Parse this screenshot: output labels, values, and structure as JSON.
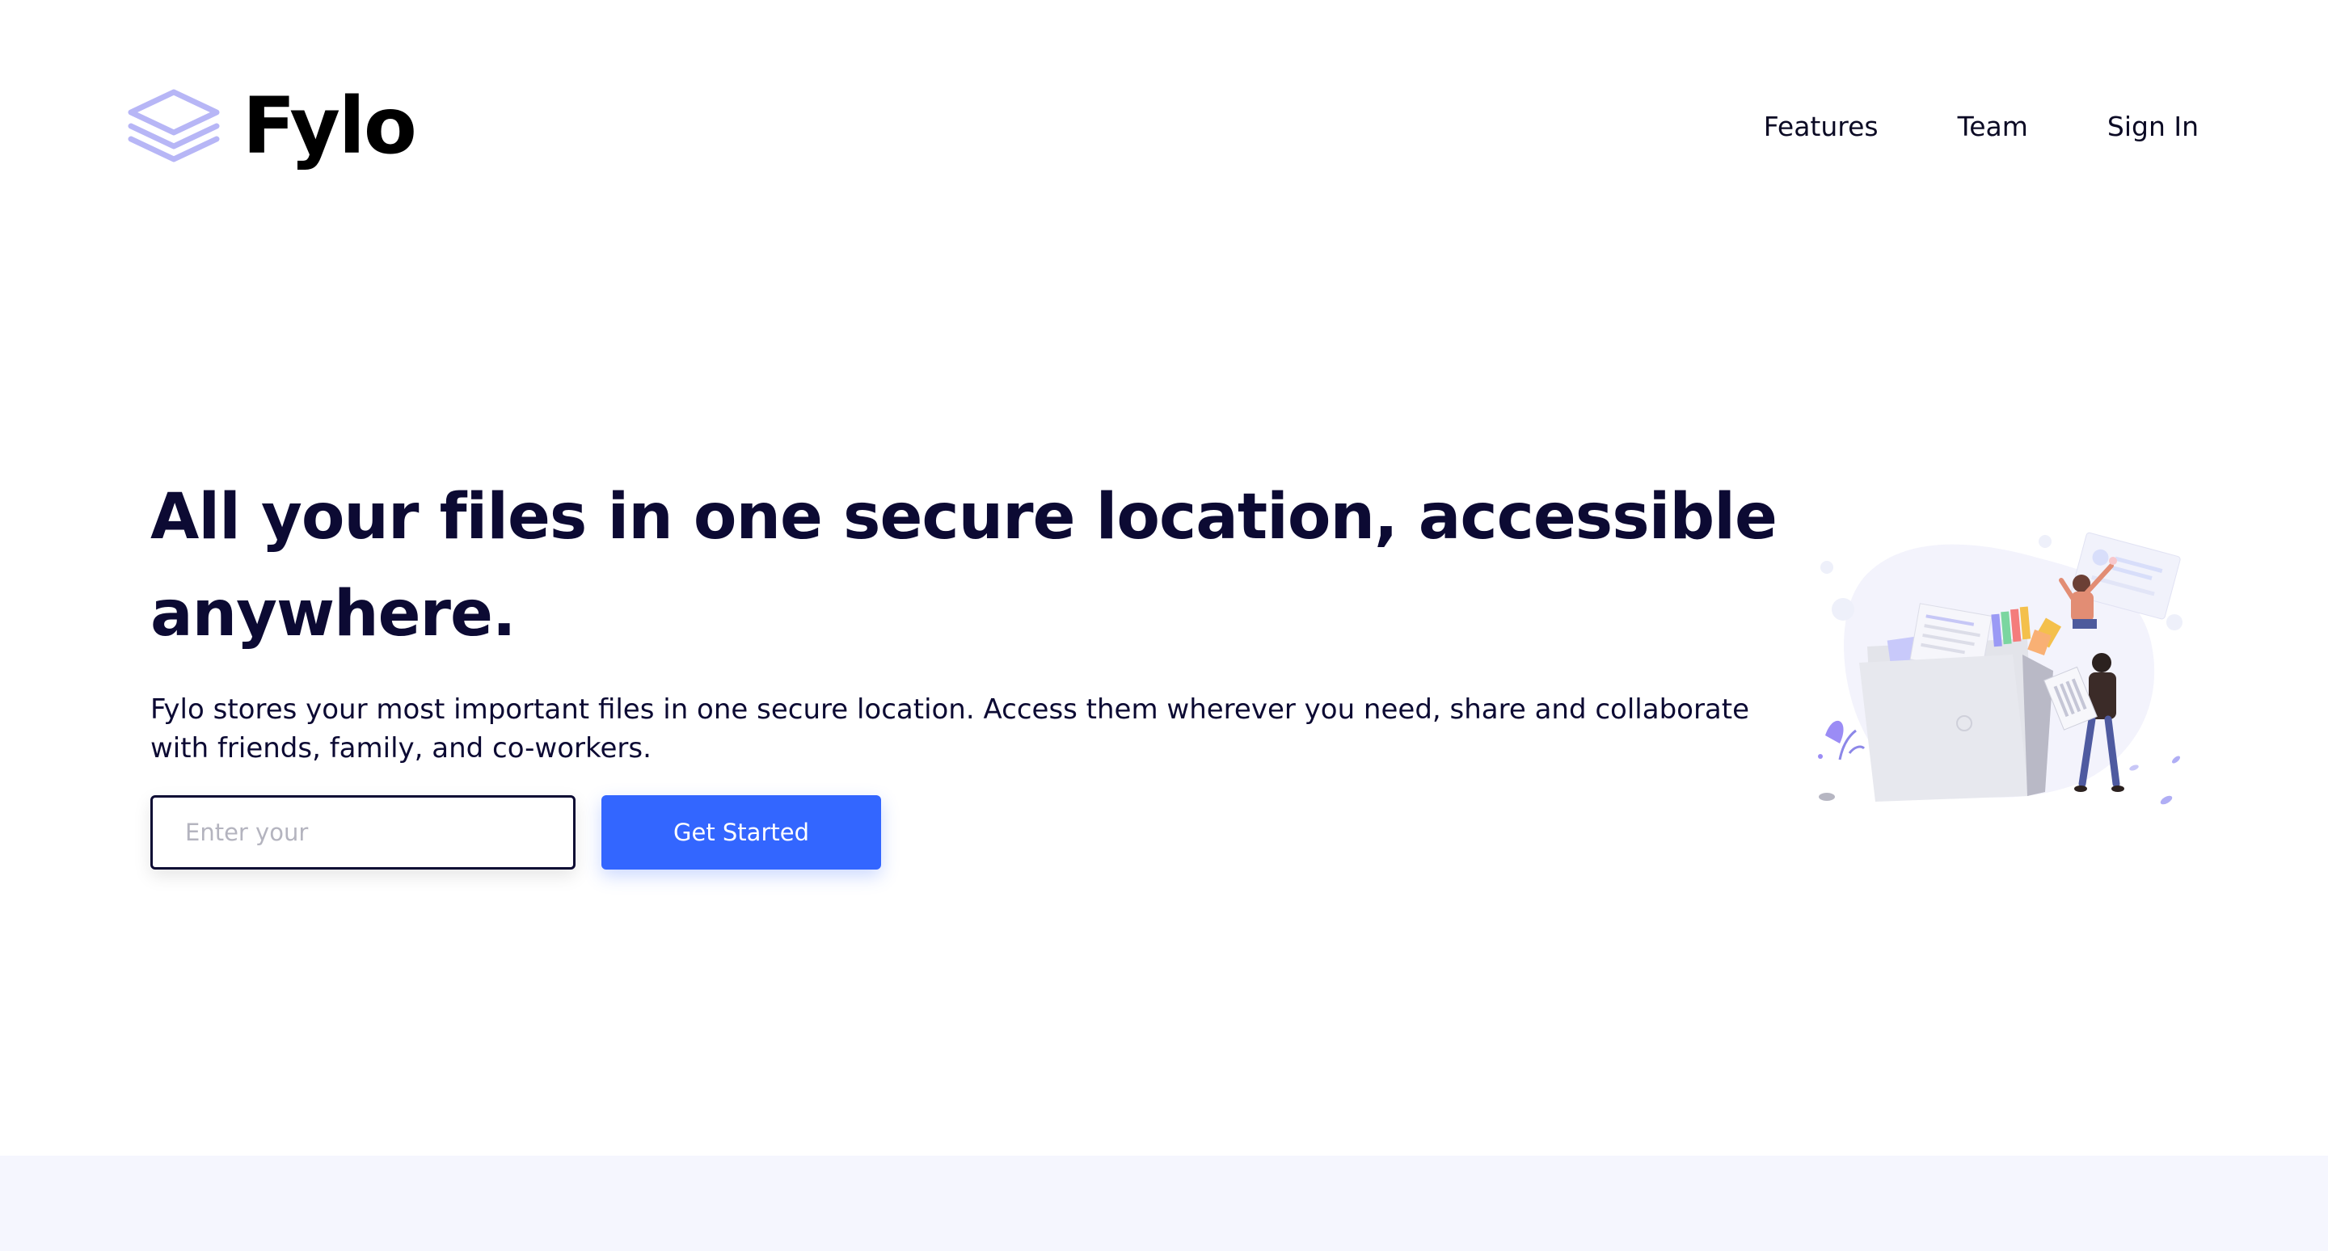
{
  "brand": {
    "name": "Fylo",
    "logo_icon": "stacked-layers-icon",
    "logo_color": "#b7b6f6"
  },
  "nav": {
    "items": [
      {
        "label": "Features"
      },
      {
        "label": "Team"
      },
      {
        "label": "Sign In"
      }
    ]
  },
  "hero": {
    "title": "All your files in one secure location, accessible anywhere.",
    "description": "Fylo stores your most important files in one secure location. Access them wherever you need, share and collaborate with friends, family, and co-workers.",
    "email_placeholder": "Enter your",
    "cta_label": "Get Started",
    "illustration": "people-filing-documents-illustration"
  },
  "colors": {
    "heading": "#0c0a33",
    "accent": "#3366ff",
    "bottom_band": "#f5f6fe"
  }
}
